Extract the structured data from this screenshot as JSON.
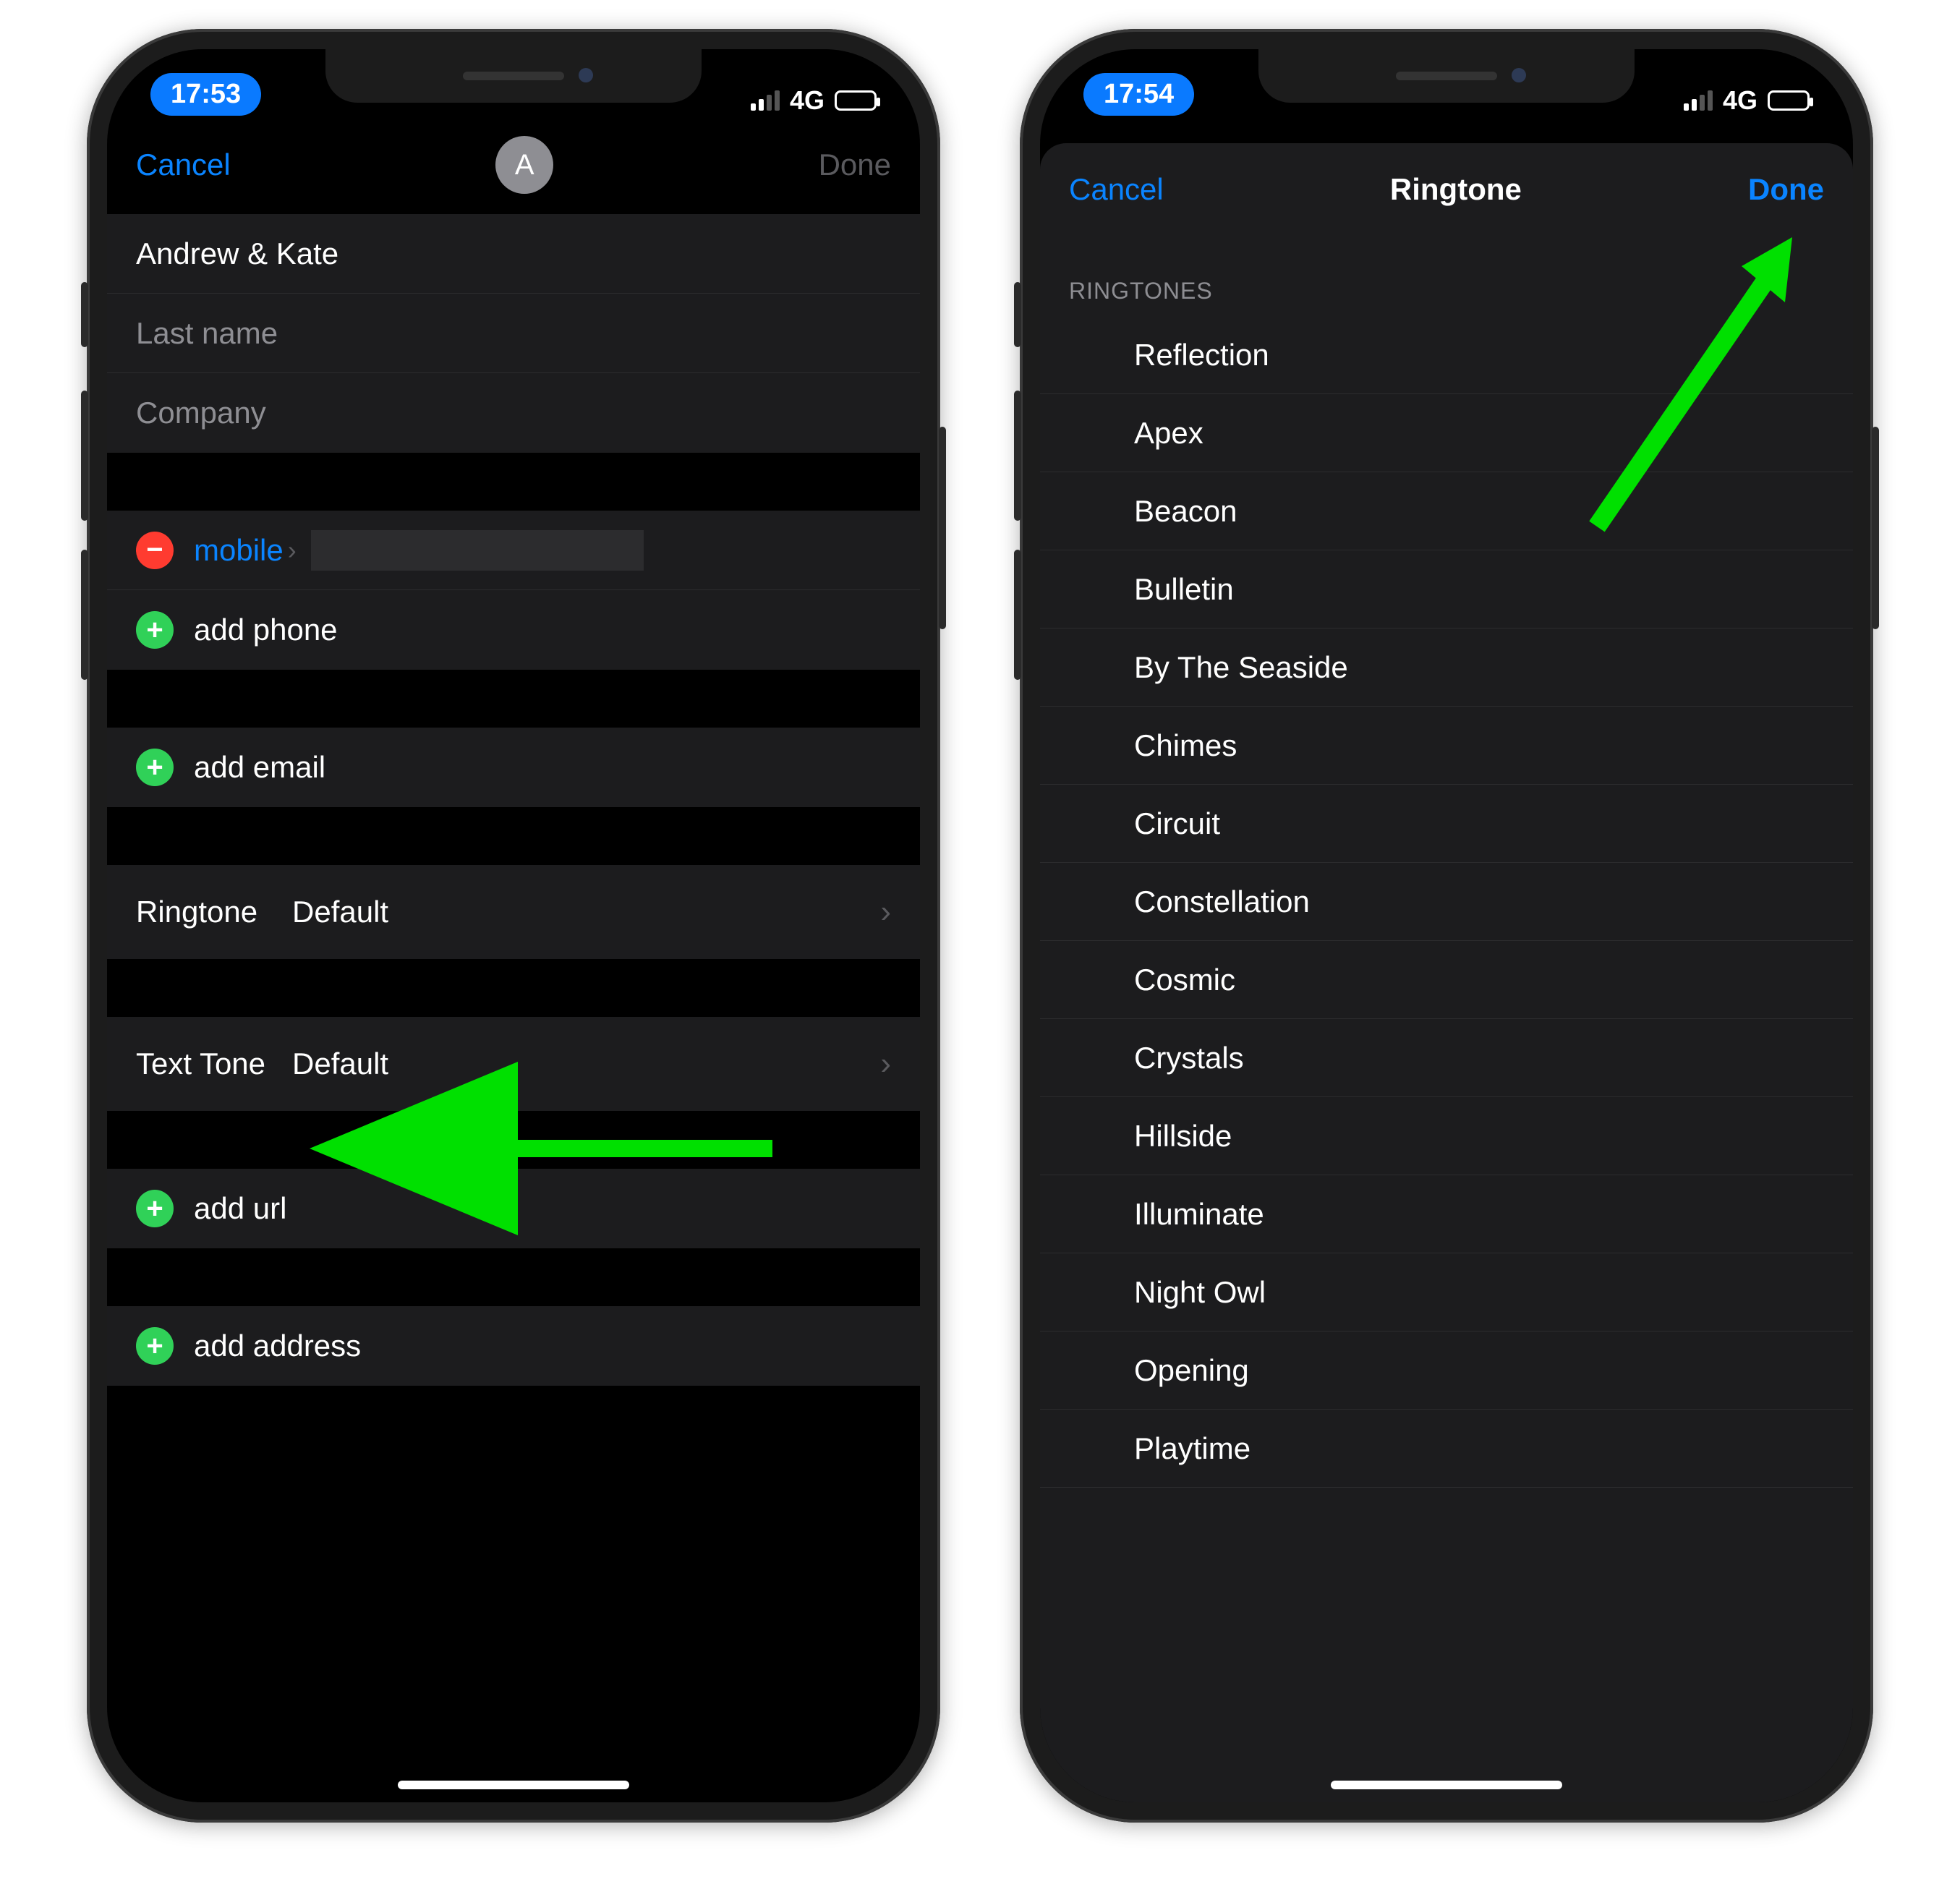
{
  "left": {
    "status": {
      "time": "17:53",
      "network": "4G"
    },
    "nav": {
      "cancel": "Cancel",
      "done": "Done",
      "avatar_initial": "A"
    },
    "fields": {
      "first_name_value": "Andrew & Kate",
      "last_name_placeholder": "Last name",
      "company_placeholder": "Company"
    },
    "phone": {
      "type_label": "mobile",
      "add_phone": "add phone"
    },
    "email": {
      "add_email": "add email"
    },
    "ringtone": {
      "label": "Ringtone",
      "value": "Default"
    },
    "texttone": {
      "label": "Text Tone",
      "value": "Default"
    },
    "url": {
      "add_url": "add url"
    },
    "address": {
      "add_address": "add address"
    }
  },
  "right": {
    "status": {
      "time": "17:54",
      "network": "4G"
    },
    "nav": {
      "cancel": "Cancel",
      "title": "Ringtone",
      "done": "Done"
    },
    "list_header": "RINGTONES",
    "ringtones": [
      "Reflection",
      "Apex",
      "Beacon",
      "Bulletin",
      "By The Seaside",
      "Chimes",
      "Circuit",
      "Constellation",
      "Cosmic",
      "Crystals",
      "Hillside",
      "Illuminate",
      "Night Owl",
      "Opening",
      "Playtime"
    ]
  },
  "colors": {
    "accent": "#0a84ff",
    "green": "#30d158",
    "red": "#ff3b30"
  }
}
